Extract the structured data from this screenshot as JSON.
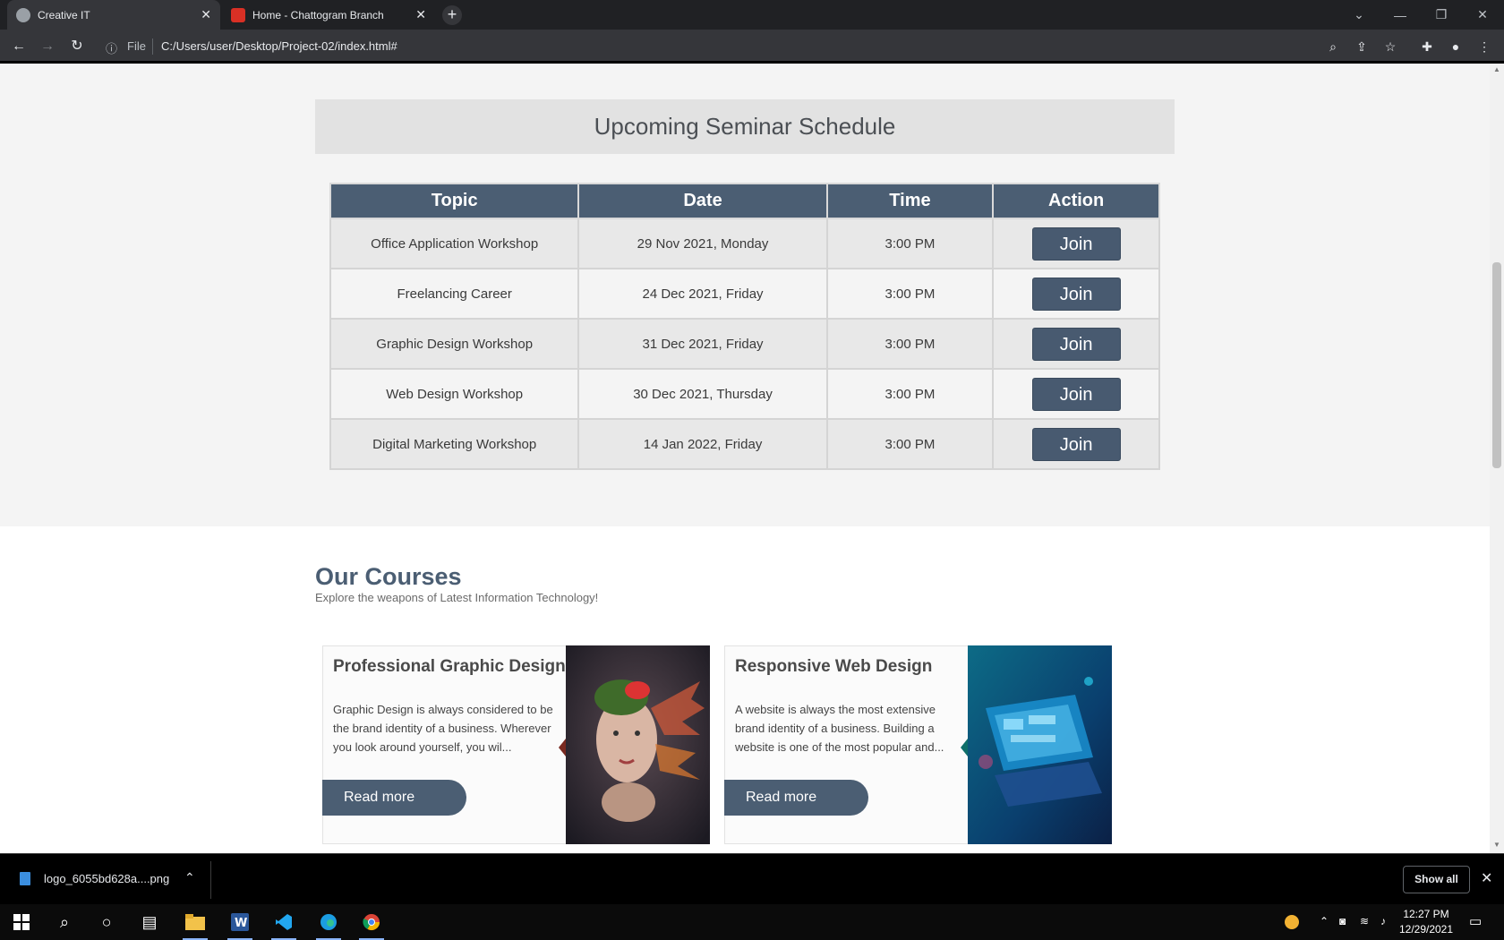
{
  "browser": {
    "tabs": [
      {
        "title": "Creative IT",
        "active": true
      },
      {
        "title": "Home - Chattogram Branch",
        "active": false
      }
    ],
    "new_tab_label": "+",
    "address": {
      "scheme_label": "File",
      "url": "C:/Users/user/Desktop/Project-02/index.html#"
    }
  },
  "seminar": {
    "heading": "Upcoming Seminar Schedule",
    "columns": [
      "Topic",
      "Date",
      "Time",
      "Action"
    ],
    "rows": [
      {
        "topic": "Office Application Workshop",
        "date": "29 Nov 2021, Monday",
        "time": "3:00 PM",
        "action": "Join"
      },
      {
        "topic": "Freelancing Career",
        "date": "24 Dec 2021, Friday",
        "time": "3:00 PM",
        "action": "Join"
      },
      {
        "topic": "Graphic Design Workshop",
        "date": "31 Dec 2021, Friday",
        "time": "3:00 PM",
        "action": "Join"
      },
      {
        "topic": "Web Design Workshop",
        "date": "30 Dec 2021, Thursday",
        "time": "3:00 PM",
        "action": "Join"
      },
      {
        "topic": "Digital Marketing Workshop",
        "date": "14 Jan 2022, Friday",
        "time": "3:00 PM",
        "action": "Join"
      }
    ]
  },
  "courses": {
    "title": "Our Courses",
    "subtitle": "Explore the weapons of Latest Information Technology!",
    "cards": [
      {
        "title": "Professional Graphic Design",
        "description": "Graphic Design is always considered to be the brand identity of a business. Wherever you look around yourself, you wil...",
        "button": "Read more"
      },
      {
        "title": "Responsive Web Design",
        "description": "A website is always the most extensive brand identity of a business. Building a website is one of the most popular and...",
        "button": "Read more"
      }
    ]
  },
  "downloads": {
    "file_name": "logo_6055bd628a....png",
    "show_all_label": "Show all"
  },
  "taskbar": {
    "time": "12:27 PM",
    "date": "12/29/2021"
  },
  "colors": {
    "accent": "#4b5e73",
    "page_bg": "#f4f4f4",
    "chrome_bg": "#35363a"
  }
}
